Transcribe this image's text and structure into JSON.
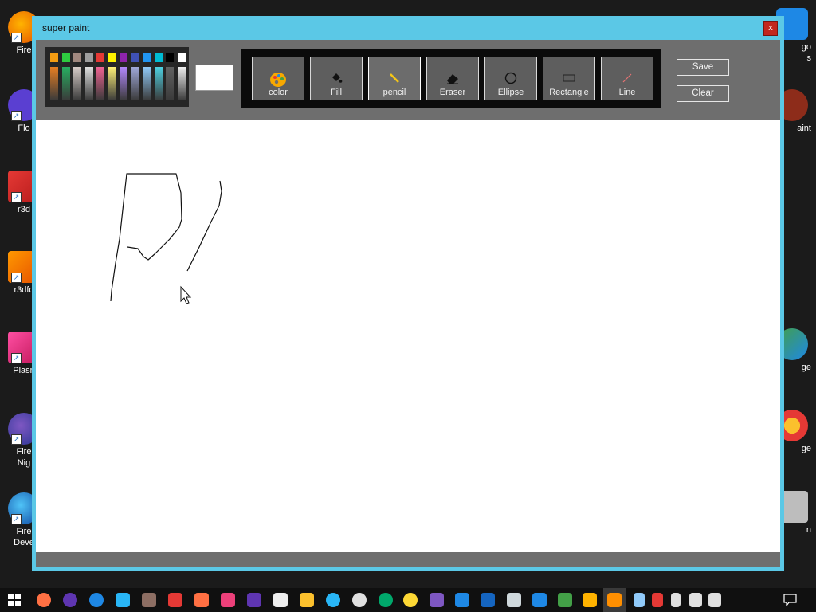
{
  "window": {
    "title": "super paint",
    "close_label": "x"
  },
  "palette": {
    "top_row": [
      "#f39c12",
      "#2ecc40",
      "#a1887f",
      "#9e9e9e",
      "#e53935",
      "#fff200",
      "#8e24aa",
      "#3f51b5",
      "#2196f3",
      "#00bcd4",
      "#000000",
      "#ffffff"
    ],
    "bottom_row": [
      "#e67e22",
      "#27ae60",
      "#d7ccc8",
      "#e0e0e0",
      "#f06292",
      "#fff176",
      "#b388ff",
      "#9fa8da",
      "#90caf9",
      "#4dd0e1",
      "#616161",
      "#eeeeee"
    ]
  },
  "current_color": "#ffffff",
  "tools": [
    {
      "id": "color",
      "label": "color",
      "icon": "palette-icon"
    },
    {
      "id": "fill",
      "label": "Fill",
      "icon": "paint-bucket-icon"
    },
    {
      "id": "pencil",
      "label": "pencil",
      "icon": "pencil-icon",
      "active": true
    },
    {
      "id": "eraser",
      "label": "Eraser",
      "icon": "eraser-icon"
    },
    {
      "id": "ellipse",
      "label": "Ellipse",
      "icon": "ellipse-icon"
    },
    {
      "id": "rectangle",
      "label": "Rectangle",
      "icon": "rectangle-icon"
    },
    {
      "id": "line",
      "label": "Line",
      "icon": "line-icon"
    }
  ],
  "buttons": {
    "save": "Save",
    "clear": "Clear"
  },
  "desktop": {
    "left_icons": [
      "Fire",
      "Flo",
      "r3d",
      "r3dfo",
      "Plasn",
      "Fire\nNig",
      "Fire\nDeve"
    ],
    "right_icons": [
      "go\ns",
      "aint",
      "ge",
      "ge",
      "n"
    ]
  },
  "colors": {
    "window_frame": "#5bc8e6",
    "toolbar": "#6e6e6e",
    "close": "#c2271f"
  }
}
